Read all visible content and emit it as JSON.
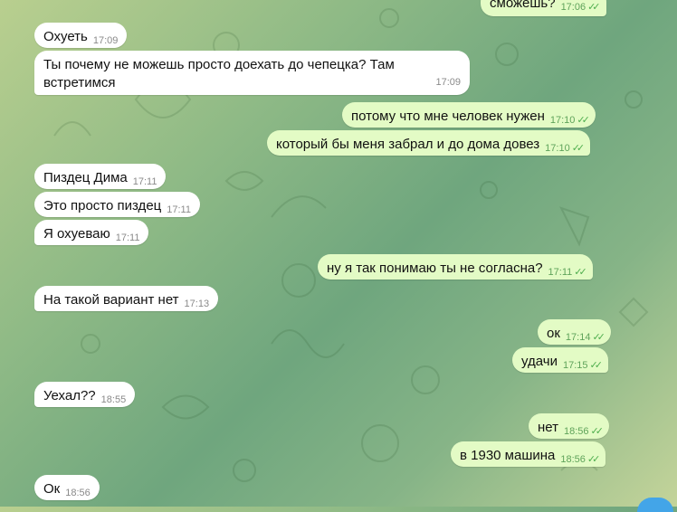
{
  "colors": {
    "incoming": "#ffffff",
    "outgoing": "#e3fbc5",
    "tick": "#4fae4e"
  },
  "messages": [
    {
      "text": "сможешь?",
      "time": "17:06",
      "dir": "out"
    },
    {
      "text": "Охуеть",
      "time": "17:09",
      "dir": "in"
    },
    {
      "text": "Ты почему не можешь просто доехать до чепецка? Там встретимся",
      "time": "17:09",
      "dir": "in"
    },
    {
      "text": "потому что мне человек нужен",
      "time": "17:10",
      "dir": "out"
    },
    {
      "text": "который бы меня забрал и до дома довез",
      "time": "17:10",
      "dir": "out"
    },
    {
      "text": "Пиздец Дима",
      "time": "17:11",
      "dir": "in"
    },
    {
      "text": "Это просто пиздец",
      "time": "17:11",
      "dir": "in"
    },
    {
      "text": "Я охуеваю",
      "time": "17:11",
      "dir": "in"
    },
    {
      "text": "ну я так понимаю ты не согласна?",
      "time": "17:11",
      "dir": "out"
    },
    {
      "text": "На такой вариант нет",
      "time": "17:13",
      "dir": "in"
    },
    {
      "text": "ок",
      "time": "17:14",
      "dir": "out"
    },
    {
      "text": "удачи",
      "time": "17:15",
      "dir": "out"
    },
    {
      "text": "Уехал??",
      "time": "18:55",
      "dir": "in"
    },
    {
      "text": "нет",
      "time": "18:56",
      "dir": "out"
    },
    {
      "text": "в 1930 машина",
      "time": "18:56",
      "dir": "out"
    },
    {
      "text": "Ок",
      "time": "18:56",
      "dir": "in"
    }
  ]
}
